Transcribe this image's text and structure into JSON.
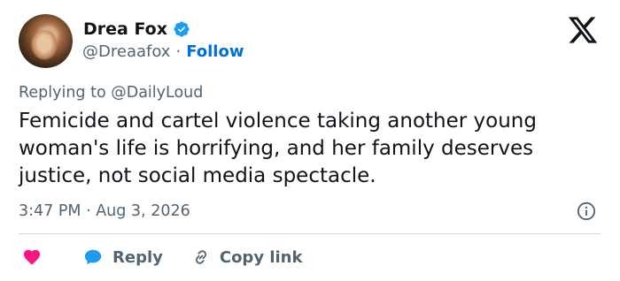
{
  "author": {
    "name": "Drea Fox",
    "handle": "@Dreaafox",
    "separator": "·",
    "follow_label": "Follow"
  },
  "replying": {
    "text": "Replying to @DailyLoud"
  },
  "tweet": {
    "text": "Femicide and cartel violence taking another young woman's life is horrifying, and her family deserves justice, not social media spectacle."
  },
  "meta": {
    "timestamp": "3:47 PM · Aug 3, 2026"
  },
  "actions": {
    "reply_label": "Reply",
    "copy_label": "Copy link"
  },
  "colors": {
    "heart": "#f91880",
    "reply_bubble": "#1d9bf0",
    "follow": "#006fd6",
    "verified": "#1d9bf0"
  },
  "icons": [
    "verified-badge-icon",
    "x-logo-icon",
    "info-icon",
    "heart-icon",
    "reply-bubble-icon",
    "link-icon"
  ]
}
